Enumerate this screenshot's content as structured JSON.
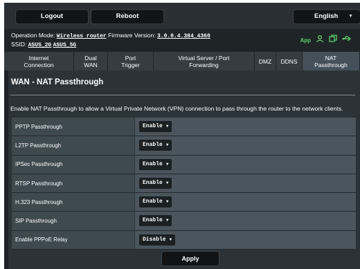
{
  "topbar": {
    "logout_label": "Logout",
    "reboot_label": "Reboot",
    "language_label": "English"
  },
  "info": {
    "op_mode_label": "Operation Mode:",
    "op_mode_value": "Wireless router",
    "firmware_label": "Firmware Version:",
    "firmware_value": "3.0.0.4.384_4360",
    "ssid_label": "SSID:",
    "ssid_2g": "ASUS_2G",
    "ssid_5g": "ASUS_5G",
    "app_label": "App",
    "status_icons": [
      "user-icon",
      "copy-icon",
      "usb-icon"
    ],
    "status_color": "#5ed46b"
  },
  "tabs": [
    {
      "label": "Internet\nConnection",
      "active": false
    },
    {
      "label": "Dual\nWAN",
      "active": false
    },
    {
      "label": "Port\nTrigger",
      "active": false
    },
    {
      "label": "Virtual Server / Port\nForwarding",
      "active": false
    },
    {
      "label": "DMZ",
      "active": false
    },
    {
      "label": "DDNS",
      "active": false
    },
    {
      "label": "NAT\nPassthrough",
      "active": true
    }
  ],
  "page": {
    "title": "WAN - NAT Passthrough",
    "description": "Enable NAT Passthrough to allow a Virtual Private Network (VPN) connection to pass through the router to the network clients."
  },
  "settings": [
    {
      "label": "PPTP Passthrough",
      "value": "Enable"
    },
    {
      "label": "L2TP Passthrough",
      "value": "Enable"
    },
    {
      "label": "IPSec Passthrough",
      "value": "Enable"
    },
    {
      "label": "RTSP Passthrough",
      "value": "Enable"
    },
    {
      "label": "H.323 Passthrough",
      "value": "Enable"
    },
    {
      "label": "SIP Passthrough",
      "value": "Enable"
    },
    {
      "label": "Enable PPPoE Relay",
      "value": "Disable"
    }
  ],
  "apply_label": "Apply"
}
